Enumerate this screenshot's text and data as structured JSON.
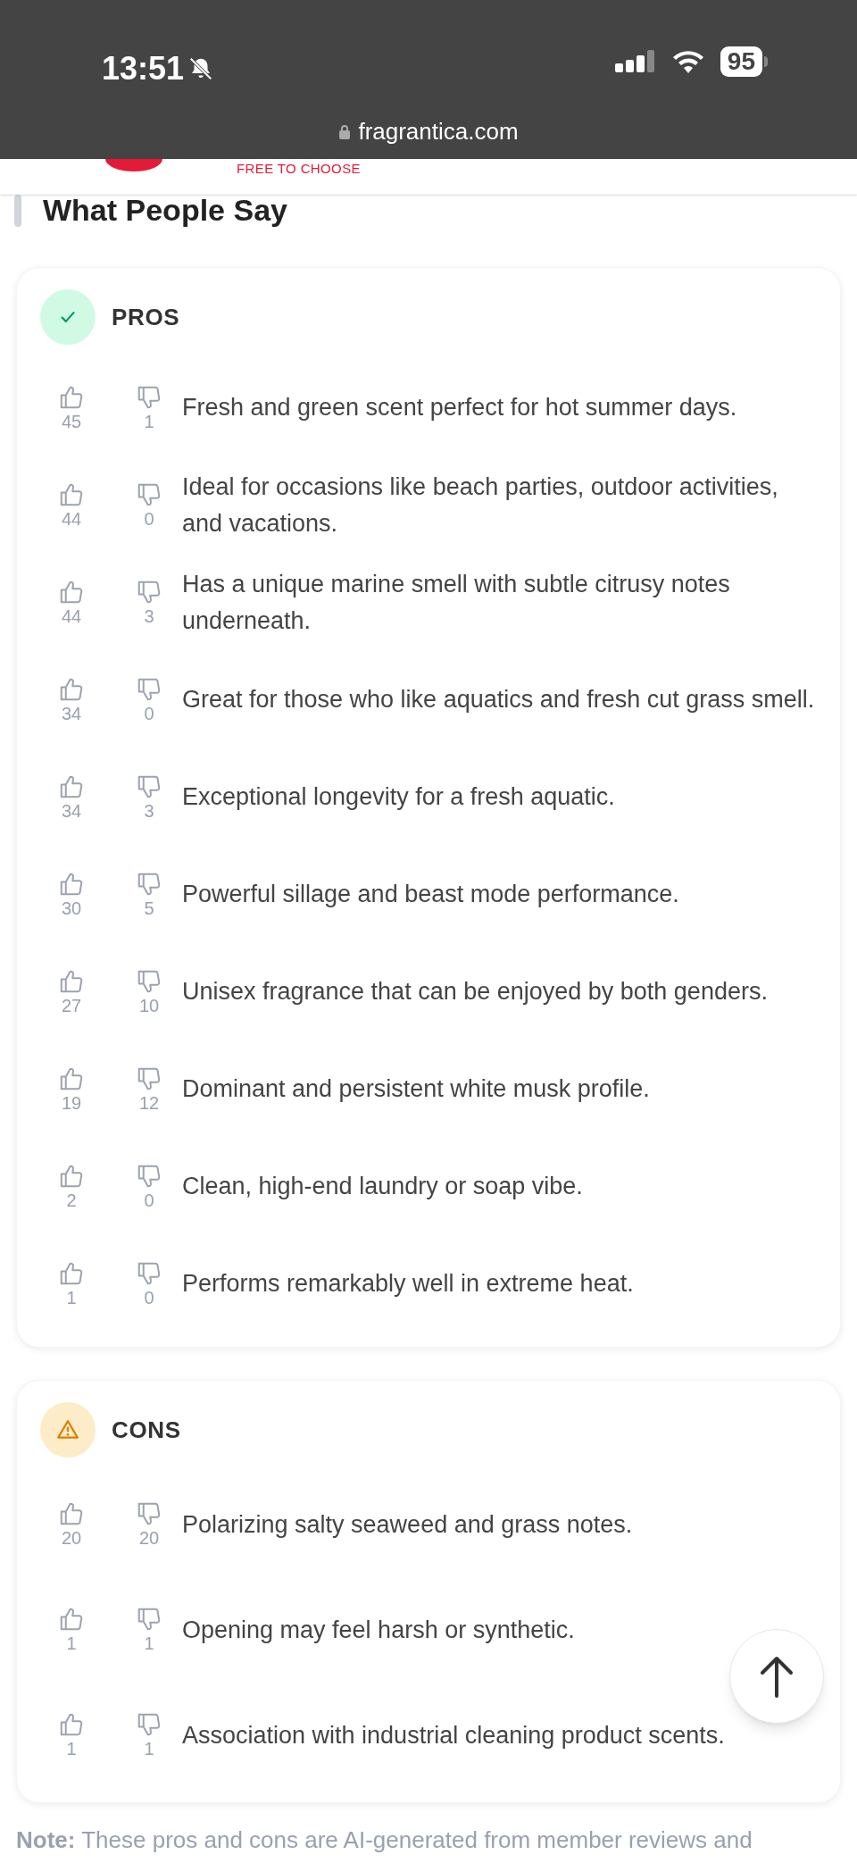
{
  "status_bar": {
    "time": "13:51",
    "battery": "95"
  },
  "browser": {
    "url": "fragrantica.com"
  },
  "header": {
    "tagline": "FREE TO CHOOSE"
  },
  "heading": "What People Say",
  "sections": [
    {
      "kind": "pros",
      "title": "PROS",
      "items": [
        {
          "text": "Fresh and green scent perfect for hot summer days.",
          "up": "45",
          "down": "1"
        },
        {
          "text": "Ideal for occasions like beach parties, outdoor activities, and vacations.",
          "up": "44",
          "down": "0"
        },
        {
          "text": "Has a unique marine smell with subtle citrusy notes underneath.",
          "up": "44",
          "down": "3"
        },
        {
          "text": "Great for those who like aquatics and fresh cut grass smell.",
          "up": "34",
          "down": "0"
        },
        {
          "text": "Exceptional longevity for a fresh aquatic.",
          "up": "34",
          "down": "3"
        },
        {
          "text": "Powerful sillage and beast mode performance.",
          "up": "30",
          "down": "5"
        },
        {
          "text": "Unisex fragrance that can be enjoyed by both genders.",
          "up": "27",
          "down": "10"
        },
        {
          "text": "Dominant and persistent white musk profile.",
          "up": "19",
          "down": "12"
        },
        {
          "text": "Clean, high-end laundry or soap vibe.",
          "up": "2",
          "down": "0"
        },
        {
          "text": "Performs remarkably well in extreme heat.",
          "up": "1",
          "down": "0"
        }
      ]
    },
    {
      "kind": "cons",
      "title": "CONS",
      "items": [
        {
          "text": "Polarizing salty seaweed and grass notes.",
          "up": "20",
          "down": "20"
        },
        {
          "text": "Opening may feel harsh or synthetic.",
          "up": "1",
          "down": "1"
        },
        {
          "text": "Association with industrial cleaning product scents.",
          "up": "1",
          "down": "1"
        }
      ]
    }
  ],
  "note": "**Note:** These pros and cons are AI-generated from member reviews and"
}
